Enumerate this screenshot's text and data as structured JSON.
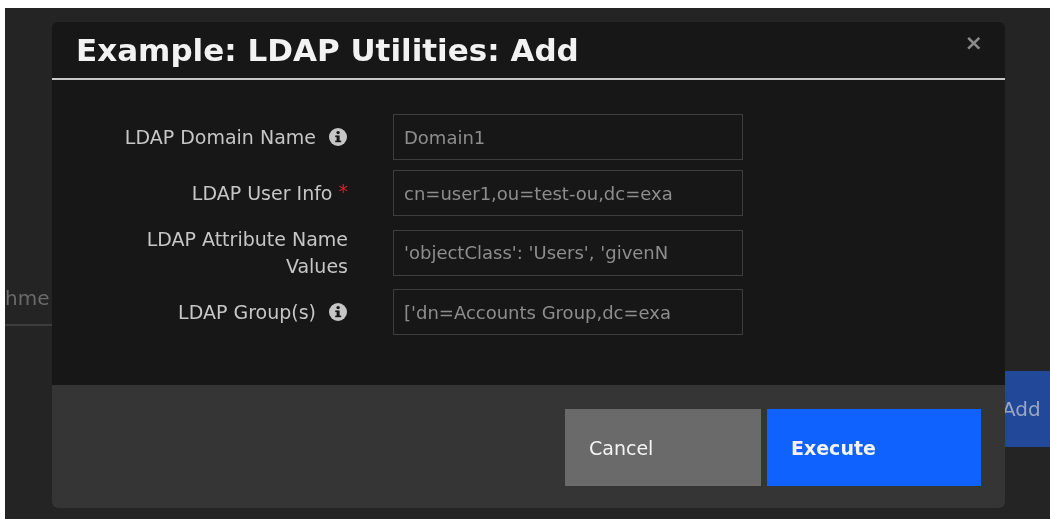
{
  "background": {
    "tab_fragment": "hme",
    "button_fragment": "Add"
  },
  "dialog": {
    "title": "Example: LDAP Utilities: Add",
    "close": "×",
    "fields": [
      {
        "label": "LDAP Domain Name",
        "info": true,
        "value": "Domain1"
      },
      {
        "label": "LDAP User Info",
        "info": false,
        "required_mark": "*",
        "value": "cn=user1,ou=test-ou,dc=exa"
      },
      {
        "label": "LDAP Attribute Name Values",
        "info": false,
        "value": "'objectClass': 'Users', 'givenN"
      },
      {
        "label": "LDAP Group(s)",
        "info": true,
        "value": "['dn=Accounts Group,dc=exa"
      }
    ],
    "buttons": [
      {
        "label": "Cancel",
        "kind": "secondary"
      },
      {
        "label": "Execute",
        "kind": "primary"
      }
    ]
  }
}
